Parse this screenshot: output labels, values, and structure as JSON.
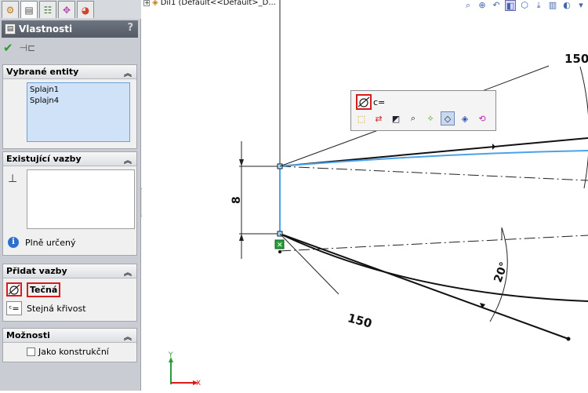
{
  "window": {
    "tree_item_label": "Díl1  (Default<<Default>_D..."
  },
  "tabs": [
    {
      "icon": "feature-manager-icon",
      "glyph": "⚙"
    },
    {
      "icon": "property-manager-icon",
      "glyph": "▤"
    },
    {
      "icon": "configuration-manager-icon",
      "glyph": "☷"
    },
    {
      "icon": "dimxpert-icon",
      "glyph": "✥"
    },
    {
      "icon": "display-manager-icon",
      "glyph": "◕"
    }
  ],
  "panel": {
    "title": "Vlastnosti",
    "help_label": "?",
    "ok_glyph": "✔",
    "pin_glyph": "⊣⊏",
    "selected_entities": {
      "title": "Vybrané entity",
      "items": [
        "Splajn1",
        "Splajn4"
      ]
    },
    "existing_relations": {
      "title": "Existující vazby",
      "status": "Plně určený"
    },
    "add_relations": {
      "title": "Přidat vazby",
      "items": [
        {
          "label": "Tečná",
          "selected": true
        },
        {
          "label": "Stejná křivost",
          "selected": false
        }
      ]
    },
    "options": {
      "title": "Možnosti",
      "construction_label": "Jako konstrukční",
      "construction_checked": false
    }
  },
  "view_toolbar": {
    "icons": [
      "zoom-to-fit-icon",
      "zoom-area-icon",
      "previous-view-icon",
      "section-view-icon",
      "view-orientation-icon",
      "display-style-icon",
      "hide-show-icon",
      "edit-appearance-icon",
      "apply-scene-icon"
    ]
  },
  "context_toolbar": {
    "top_label": "c=",
    "tools": [
      "select-other-icon",
      "relations-icon",
      "smart-dimension-icon",
      "zoom-selection-icon",
      "show-curvature-icon",
      "tangent-icon",
      "equal-curvature-icon",
      "convert-icon"
    ]
  },
  "canvas": {
    "dimensions": [
      "150",
      "150",
      "8",
      "20°"
    ],
    "axis_labels": {
      "y": "Y",
      "x": "X"
    }
  },
  "colors": {
    "panel_bg": "#c9cdd3",
    "header_bg": "#5f6671",
    "selection_blue": "#cfe2f7",
    "sketch_blue": "#4aa3ea",
    "highlight_red": "#d81c1c",
    "ok_green": "#2e9b2e"
  }
}
